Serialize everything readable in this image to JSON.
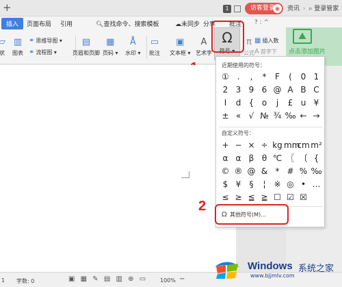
{
  "titlebar": {
    "badge": "1",
    "visitor_label": "访客登录",
    "browser_right": [
      "资讯",
      "登录管家"
    ]
  },
  "ribbon": {
    "tabs": [
      "插入",
      "页面布局",
      "引用"
    ],
    "search_cmd": "查找命令、搜索模板",
    "unsync": "未同步",
    "share": "分享",
    "batch": "批注",
    "tabs_more": "? : ^",
    "buttons": {
      "shape": "状",
      "chart": "图表",
      "qrcode": "思维导图",
      "flowchart": "流程图",
      "header_footer": "页眉和页脚",
      "page_number": "页码",
      "watermark": "水印",
      "comment": "批注",
      "textbox": "文本框",
      "art": "艺术字",
      "symbol": "符号",
      "formula": "公式",
      "insert_num": "插入数",
      "first_letter": "首字下"
    },
    "add_picture": "点击添加图片"
  },
  "dropdown": {
    "recent_title": "近期使用的符号：",
    "recent_symbols": [
      "①",
      ".",
      ",",
      "*",
      "F",
      "(",
      "0",
      "1",
      "2",
      "3",
      "9",
      "6",
      "@",
      "A",
      "B",
      "C",
      "I",
      "d",
      "{",
      "o",
      "j",
      "£",
      "u",
      "¥",
      "±",
      "«",
      "√",
      "№",
      "¾",
      "‰",
      "←",
      "→"
    ],
    "custom_title": "自定义符号：",
    "custom_symbols": [
      "+",
      "−",
      "×",
      "÷",
      "kg",
      "mm",
      "cm",
      "m²",
      "α",
      "α",
      "β",
      "θ",
      "℃",
      "〖",
      "〔",
      "{",
      "©",
      "®",
      "@",
      "&",
      "*",
      "#",
      "%",
      "‰",
      "$",
      "¥",
      "§",
      "¦",
      "※",
      "◎",
      "•",
      "…",
      "≤",
      "≥",
      "≦",
      "≧",
      "☐",
      "☑",
      "☒",
      ""
    ],
    "more_symbols": "其他符号(M)..."
  },
  "annotations": {
    "step1": "1",
    "step2": "2"
  },
  "statusbar": {
    "pages": "1",
    "words": "字数: 0",
    "zoom": "100%",
    "zoom_minus": "−"
  },
  "watermark": {
    "word": "Windows",
    "cn": "系统之家",
    "url": "www.bjjmlv.com"
  },
  "colors": {
    "accent": "#3f7fe0",
    "highlight": "#e02020",
    "visitor": "#e25550",
    "add_picture": "#39a84e"
  }
}
